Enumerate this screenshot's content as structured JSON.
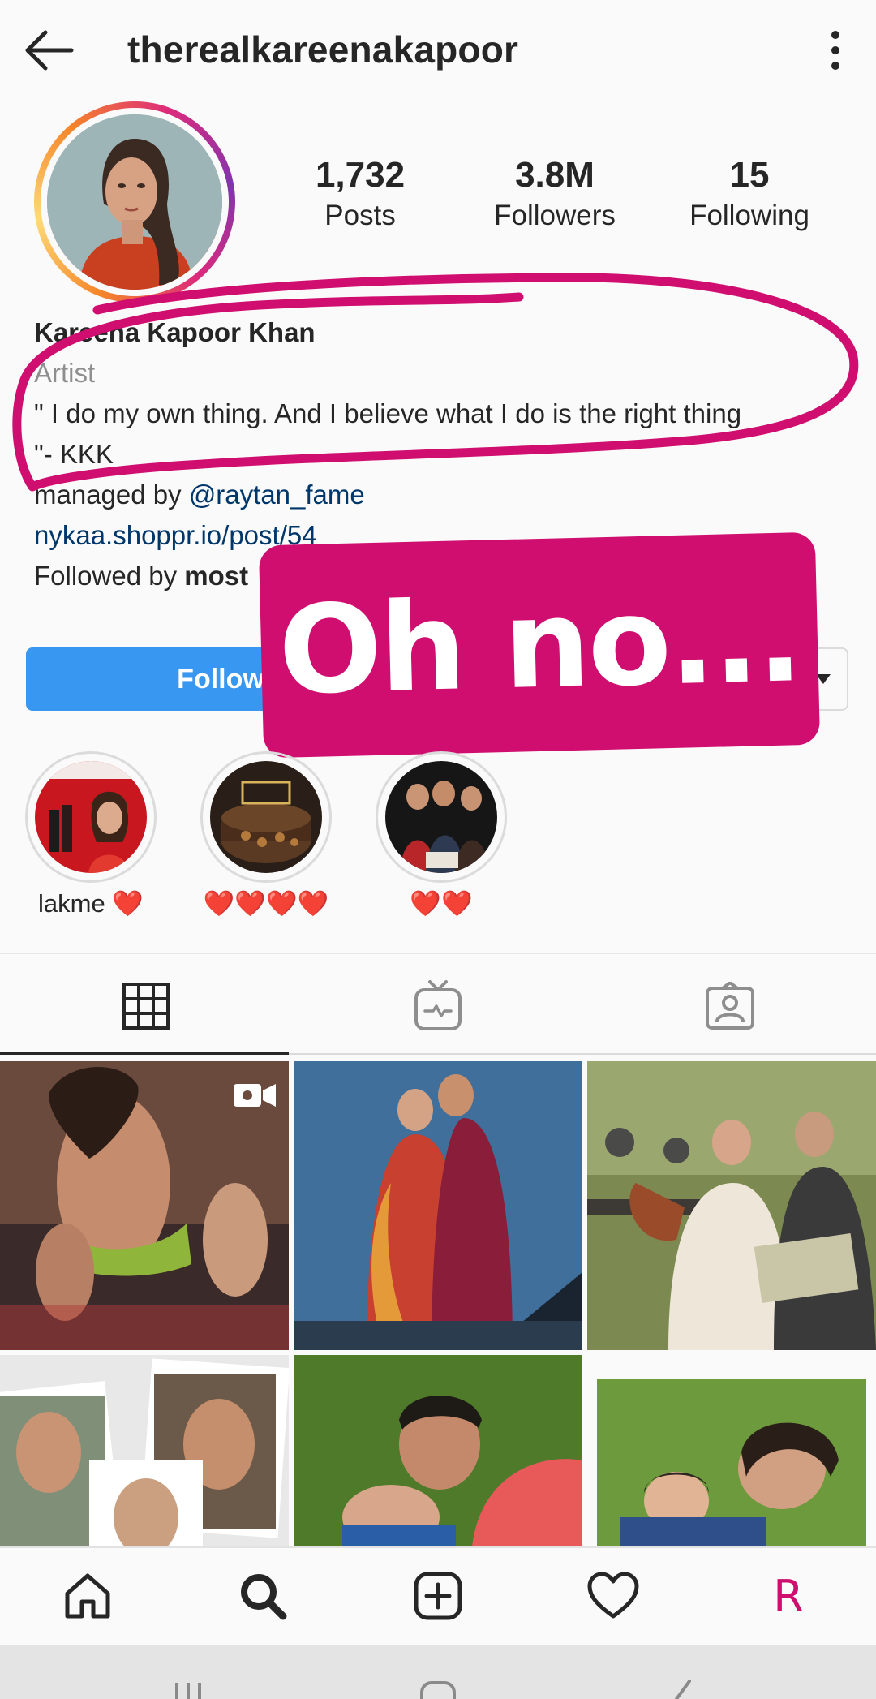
{
  "header": {
    "username": "therealkareenakapoor"
  },
  "stats": {
    "posts_count": "1,732",
    "posts_label": "Posts",
    "followers_count": "3.8M",
    "followers_label": "Followers",
    "following_count": "15",
    "following_label": "Following"
  },
  "bio": {
    "name": "Kareena Kapoor Khan",
    "category": "Artist",
    "quote_line1": "\" I do my own thing. And I believe what I do is the right thing",
    "quote_line2": "\"- KKK",
    "managed_prefix": "managed by ",
    "managed_handle": "@raytan_fame",
    "link": "nykaa.shoppr.io/post/54",
    "followed_prefix": "Followed by ",
    "followed_names": "most"
  },
  "actions": {
    "follow_label": "Follow"
  },
  "sticker": {
    "text": "Oh no..."
  },
  "annotation": {
    "circle_color": "#cf0e6f"
  },
  "highlights": [
    {
      "label": "lakme",
      "hearts": "❤️"
    },
    {
      "label": "",
      "hearts": "❤️❤️❤️❤️"
    },
    {
      "label": "",
      "hearts": "❤️❤️"
    }
  ],
  "colors": {
    "accent_blue": "#3897f0",
    "link_blue": "#00376b",
    "sticker_pink": "#cf0e6f",
    "text_dark": "#262626",
    "text_muted": "#8e8e8e"
  },
  "bottom_nav": {
    "profile_initial": "R"
  },
  "tabs": [
    "grid-icon",
    "igtv-icon",
    "tagged-icon"
  ]
}
